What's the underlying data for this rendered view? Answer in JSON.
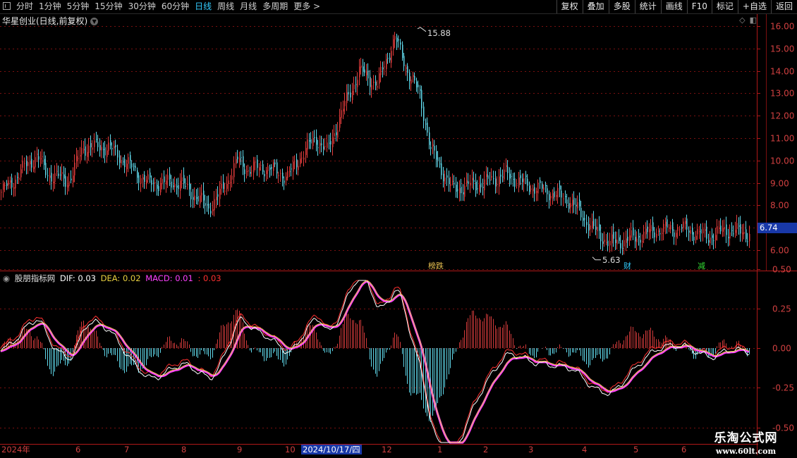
{
  "toolbar": {
    "left": [
      "分时",
      "1分钟",
      "5分钟",
      "15分钟",
      "30分钟",
      "60分钟",
      "日线",
      "周线",
      "月线",
      "多周期",
      "更多 >"
    ],
    "active": "日线",
    "right": [
      "复权",
      "叠加",
      "多股",
      "统计",
      "画线",
      "F10",
      "标记",
      "+自选",
      "返回"
    ]
  },
  "main_panel": {
    "title": "华星创业(日线,前复权)",
    "y_ticks": [
      "16.00",
      "15.00",
      "14.00",
      "13.00",
      "12.00",
      "11.00",
      "10.00",
      "9.00",
      "8.00",
      "7.00",
      "6.00"
    ],
    "current_price": "6.74",
    "high_label": "15.88",
    "low_label": "5.63",
    "event_tags": [
      {
        "text": "榜跌",
        "color": "#e8c050"
      },
      {
        "text": "财",
        "color": "#33ccff"
      },
      {
        "text": "减",
        "color": "#33dd33"
      }
    ],
    "colors": {
      "up": "#e23c3c",
      "down": "#5fd6e8",
      "grid": "#7a1010",
      "axis": "#b01818"
    }
  },
  "indicator_panel": {
    "name": "股朋指标网",
    "dif_label": "DIF: 0.03",
    "dea_label": "DEA: 0.02",
    "macd_label": "MACD: 0.01",
    "extra_label": ": 0.03",
    "y_ticks": [
      "0.50",
      "0.25",
      "0.00",
      "-0.25",
      "-0.50"
    ],
    "colors": {
      "dif": "#ffffff",
      "dea": "#e8d040",
      "macd": "#ff40ff",
      "extra": "#ff3030",
      "hist_up": "#d03a3a",
      "hist_down": "#5fd6e8"
    }
  },
  "date_axis": {
    "labels": [
      "2024年",
      "6",
      "7",
      "8",
      "9",
      "10",
      "12",
      "1",
      "2",
      "3",
      "4",
      "5",
      "6"
    ],
    "cursor_date": "2024/10/17/四"
  },
  "watermark": {
    "line1": "乐淘公式网",
    "line2": "www.60lt.com"
  }
}
